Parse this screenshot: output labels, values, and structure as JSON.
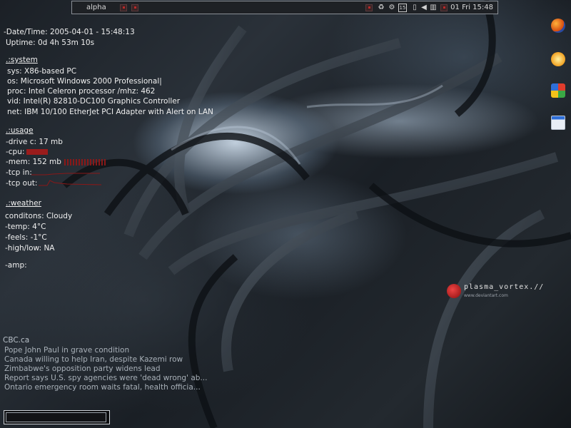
{
  "topbar": {
    "title": "alpha",
    "tray_badge": "15",
    "clock": "01 Fri 15:48"
  },
  "monitor": {
    "datetime": "-Date/Time: 2005-04-01 - 15:48:13",
    "uptime": "Uptime: 0d 4h 53m 10s",
    "system_header": ".:system",
    "sys": "sys: X86-based PC",
    "os": "os: Microsoft Windows 2000 Professional|",
    "proc": "proc: Intel Celeron processor /mhz: 462",
    "vid": "vid: Intel(R) 82810-DC100 Graphics Controller",
    "net": "net: IBM 10/100 EtherJet PCI Adapter with Alert on LAN",
    "usage_header": ".:usage",
    "drive": "-drive c: 17 mb",
    "cpu": "-cpu:",
    "mem": "-mem: 152 mb",
    "tcp_in": "-tcp in:",
    "tcp_out": "-tcp out:",
    "weather_header": ".:weather",
    "conditions": "conditons: Cloudy",
    "temp": "-temp: 4°C",
    "feels": "-feels: -1°C",
    "highlow": "-high/low: NA",
    "amp": "-amp:"
  },
  "news": {
    "source": "CBC.ca",
    "items": [
      "Pope John Paul in grave condition",
      "Canada willing to help Iran, despite Kazemi row",
      "Zimbabwe's opposition party widens lead",
      "Report says U.S. spy agencies were 'dead wrong' ab...",
      "Ontario emergency room waits fatal, health officia..."
    ]
  },
  "logo": {
    "title": "plasma_vortex.//",
    "url": "www.deviantart.com"
  },
  "colors": {
    "accent_red": "#9a1c1c",
    "text": "#f0f0f0",
    "news": "#a8b0b8"
  },
  "icons": [
    "firefox-icon",
    "weather-icon",
    "windows-icon",
    "window-icon"
  ]
}
